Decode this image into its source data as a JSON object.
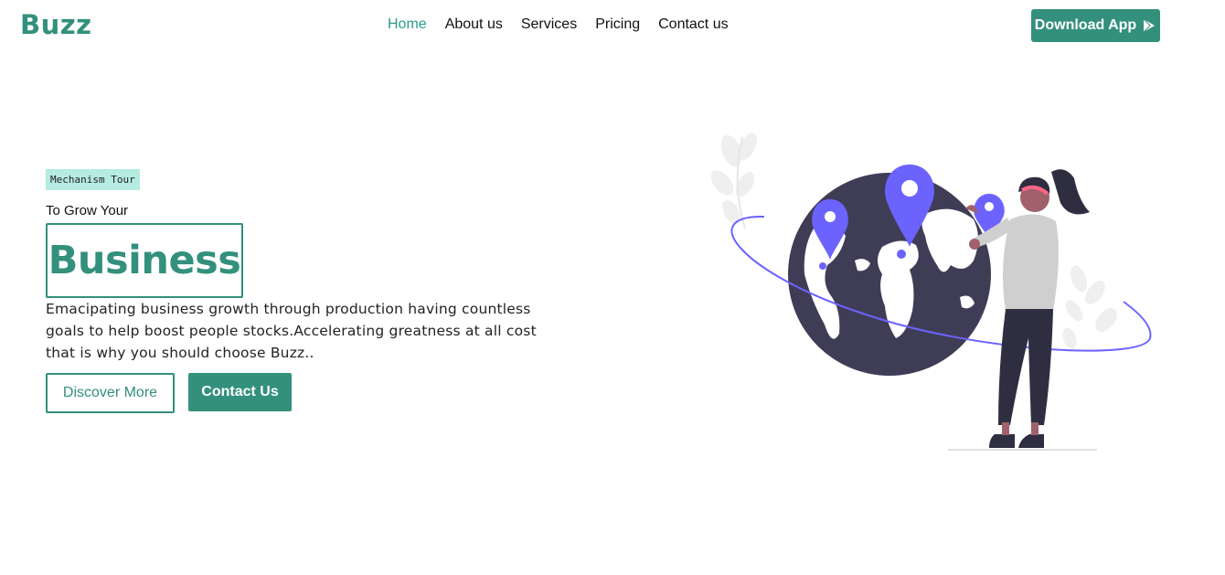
{
  "brand": {
    "logo_text": "Buzz",
    "accent_color": "#33907c"
  },
  "nav": {
    "items": [
      {
        "label": "Home",
        "active": true
      },
      {
        "label": "About us",
        "active": false
      },
      {
        "label": "Services",
        "active": false
      },
      {
        "label": "Pricing",
        "active": false
      },
      {
        "label": "Contact us",
        "active": false
      }
    ],
    "download_label": "Download App",
    "download_icon": "play-store-icon"
  },
  "hero": {
    "tag": "Mechanism Tour",
    "subtitle": "To Grow Your",
    "headline": "Business",
    "description": "Emacipating business growth through production having countless goals to help boost people stocks.Accelerating greatness at all cost that is why you should choose Buzz..",
    "primary_cta": "Discover More",
    "secondary_cta": "Contact Us"
  },
  "illustration": {
    "subject": "woman-placing-location-pins-on-globe",
    "pin_color": "#6c63ff",
    "globe_color": "#3f3d56"
  }
}
